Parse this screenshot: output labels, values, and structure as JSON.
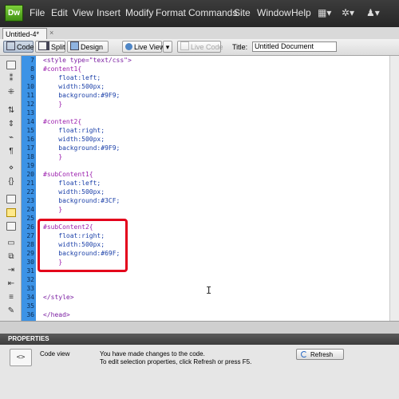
{
  "app": {
    "logo": "Dw"
  },
  "menu": [
    "File",
    "Edit",
    "View",
    "Insert",
    "Modify",
    "Format",
    "Commands",
    "Site",
    "Window",
    "Help"
  ],
  "menubar_icons": [
    "layout-icon",
    "gear-icon",
    "user-icon"
  ],
  "document": {
    "tab": "Untitled-4*",
    "close": "×"
  },
  "toolbar": {
    "code": "Code",
    "split": "Split",
    "design": "Design",
    "live_view": "Live View",
    "live_code": "Live Code",
    "title_label": "Title:",
    "title_value": "Untitled Document"
  },
  "line_numbers": [
    "7",
    "8",
    "9",
    "10",
    "11",
    "12",
    "13",
    "14",
    "15",
    "16",
    "17",
    "18",
    "19",
    "20",
    "21",
    "22",
    "23",
    "24",
    "25",
    "26",
    "27",
    "28",
    "29",
    "30",
    "31",
    "32",
    "33",
    "34",
    "35",
    "36"
  ],
  "code_lines": [
    "<style type=\"text/css\">",
    "#content1{",
    "    float:left;",
    "    width:500px;",
    "    background:#9F9;",
    "    }",
    "",
    "#content2{",
    "    float:right;",
    "    width:500px;",
    "    background:#9F9;",
    "    }",
    "",
    "#subContent1{",
    "    float:left;",
    "    width:500px;",
    "    background:#3CF;",
    "    }",
    "",
    "#subContent2{",
    "    float:right;",
    "    width:500px;",
    "    background:#69F;",
    "    }",
    "",
    "",
    "",
    "</style>",
    "",
    "</head>"
  ],
  "properties": {
    "title": "PROPERTIES",
    "icon_glyph": "<>",
    "label": "Code view",
    "message_line1": "You have made changes to the code.",
    "message_line2": "To edit selection properties, click Refresh or press F5.",
    "refresh": "Refresh"
  },
  "colors": {
    "gutter": "#3c93e6",
    "highlight": "#e3001b",
    "menubar": "#2e2e2e"
  }
}
